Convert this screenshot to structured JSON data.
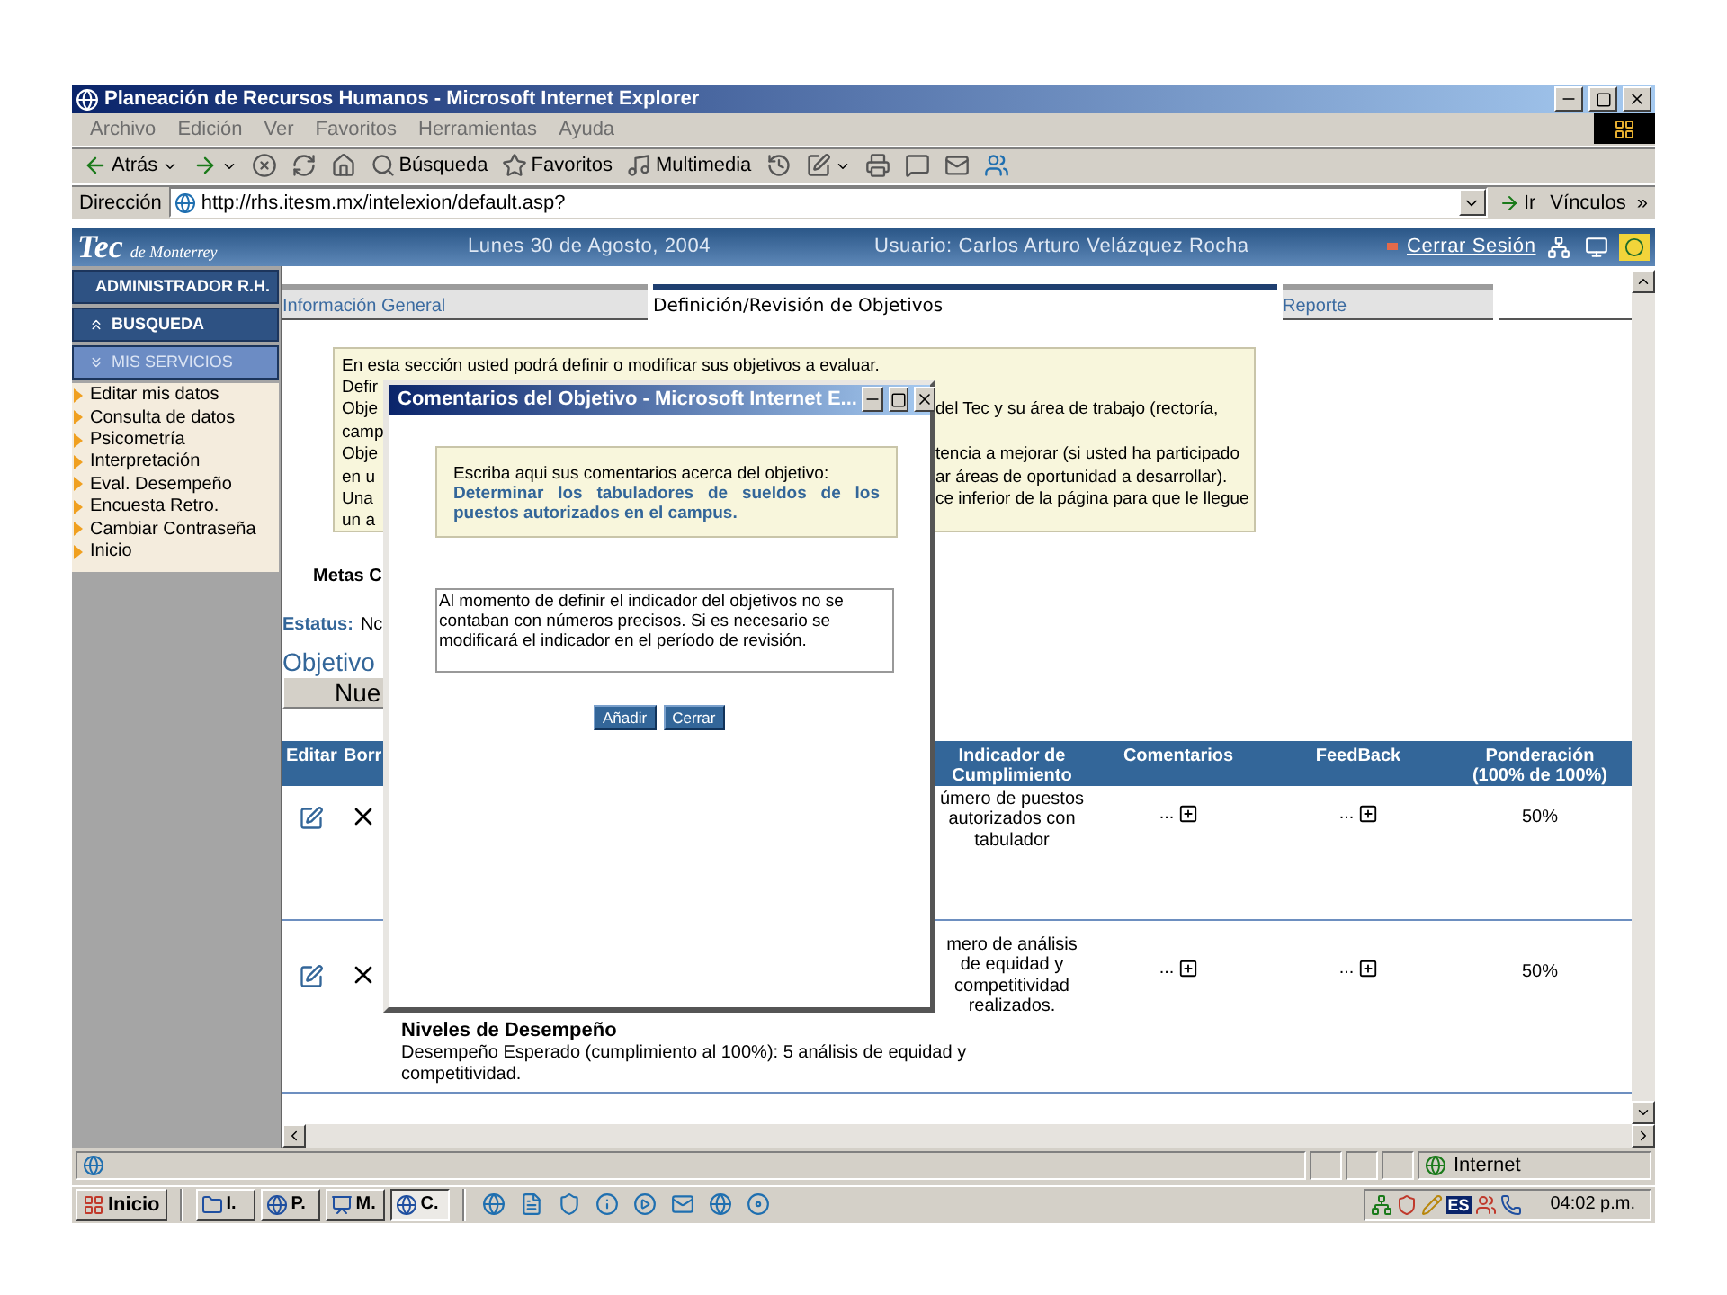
{
  "window": {
    "title": "Planeación de Recursos Humanos - Microsoft Internet Explorer"
  },
  "menu": [
    "Archivo",
    "Edición",
    "Ver",
    "Favoritos",
    "Herramientas",
    "Ayuda"
  ],
  "toolbar": [
    {
      "kind": "back",
      "label": "Atrás",
      "menu": true
    },
    {
      "kind": "forward",
      "menu": true
    },
    {
      "kind": "stop"
    },
    {
      "kind": "refresh"
    },
    {
      "kind": "home"
    },
    {
      "kind": "search",
      "label": "Búsqueda"
    },
    {
      "kind": "favorites",
      "label": "Favoritos"
    },
    {
      "kind": "media",
      "label": "Multimedia"
    },
    {
      "kind": "history"
    },
    {
      "kind": "edit",
      "menu": true
    },
    {
      "kind": "print"
    },
    {
      "kind": "discuss"
    },
    {
      "kind": "mail"
    },
    {
      "kind": "messenger"
    }
  ],
  "address": {
    "label": "Dirección",
    "value": "http://rhs.itesm.mx/intelexion/default.asp?",
    "go": "Ir",
    "links": "Vínculos",
    "more": "»"
  },
  "header": {
    "logo_main": "Tec",
    "logo_sub": "de Monterrey",
    "date": "Lunes 30 de Agosto, 2004",
    "user": "Usuario: Carlos Arturo Velázquez Rocha",
    "logout": "Cerrar Sesión"
  },
  "sidebar": {
    "sections": [
      {
        "label": "ADMINISTRADOR R.H.",
        "expanded": false
      },
      {
        "label": "BUSQUEDA",
        "expanded": false
      },
      {
        "label": "MIS SERVICIOS",
        "expanded": true,
        "items": [
          "Editar mis datos",
          "Consulta de datos",
          "Psicometría",
          "Interpretación",
          "Eval. Desempeño",
          "Encuesta Retro.",
          "Cambiar Contraseña",
          "Inicio"
        ]
      }
    ]
  },
  "tabs": [
    {
      "label": "Información General",
      "selected": false
    },
    {
      "label": "Definición/Revisión de Objetivos",
      "selected": true
    },
    {
      "label": "Reporte",
      "selected": false
    }
  ],
  "intro": {
    "first_line": "En esta sección usted podrá definir o modificar sus objetivos a evaluar.",
    "lines": [
      {
        "left": "Defir"
      },
      {
        "left": "Obje",
        "right": "del Tec y su área de trabajo (rectoría,"
      },
      {
        "left": "camp"
      },
      {
        "left": "Obje",
        "right": "tencia a mejorar (si usted ha participado"
      },
      {
        "left": "en u",
        "right": "ar áreas de oportunidad a desarrollar)."
      },
      {
        "left": "Una",
        "right": "ce inferior de la página para que le llegue"
      },
      {
        "left": "un a"
      }
    ]
  },
  "goals_title": "Metas C",
  "status": {
    "label": "Estatus:",
    "value": "Nc"
  },
  "objectives_title": "Objetivo",
  "new_button": "Nue",
  "table": {
    "columns_left": [
      "Editar",
      "Borr"
    ],
    "columns_right": [
      "Indicador de Cumplimiento",
      "Comentarios",
      "FeedBack",
      "Ponderación (100% de 100%)"
    ],
    "rows": [
      {
        "indicator": "úmero de puestos autorizados con tabulador",
        "comments": "...",
        "feedback": "...",
        "weight": "50%"
      },
      {
        "indicator": "mero de análisis de equidad y competitividad realizados.",
        "comments": "...",
        "feedback": "...",
        "weight": "50%",
        "details": {
          "title": "Niveles de Desempeño",
          "text": "Desempeño Esperado (cumplimiento al 100%): 5 análisis de equidad y competitividad."
        }
      }
    ]
  },
  "dialog": {
    "title": "Comentarios del Objetivo - Microsoft Internet E...",
    "prompt": "Escriba aqui sus comentarios acerca del objetivo:",
    "objective": "Determinar los tabuladores de sueldos de los puestos autorizados en el campus.",
    "comment": "Al momento de definir el indicador del objetivos no se contaban con números precisos. Si es necesario se modificará el indicador en el período de revisión.",
    "buttons": [
      "Añadir",
      "Cerrar"
    ]
  },
  "status_bar": {
    "zone": "Internet"
  },
  "taskbar": {
    "start": "Inicio",
    "tasks": [
      {
        "label": "I.",
        "kind": "folder",
        "selected": false
      },
      {
        "label": "P.",
        "kind": "browser",
        "selected": false
      },
      {
        "label": "M.",
        "kind": "slides",
        "selected": false
      },
      {
        "label": "C.",
        "kind": "browser",
        "selected": true
      }
    ],
    "language": "ES",
    "clock": "04:02 p.m."
  }
}
